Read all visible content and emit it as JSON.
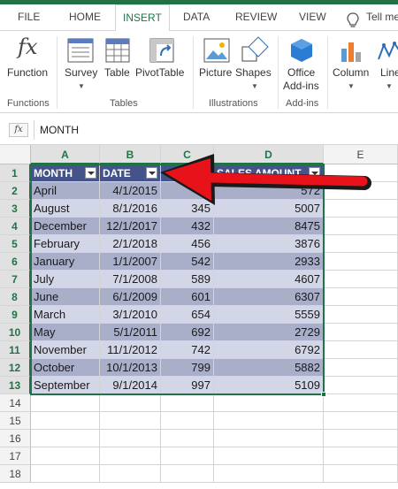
{
  "tabs": [
    "FILE",
    "HOME",
    "INSERT",
    "DATA",
    "REVIEW",
    "VIEW",
    "Tell me"
  ],
  "ribbon": {
    "function_label": "Function",
    "survey_label": "Survey",
    "table_label": "Table",
    "pivot_label": "PivotTable",
    "picture_label": "Picture",
    "shapes_label": "Shapes",
    "office_label_1": "Office",
    "office_label_2": "Add-ins",
    "column_label": "Column",
    "line_label": "Line",
    "fx_symbol": "fx",
    "groups": [
      "Functions",
      "Tables",
      "Illustrations",
      "Add-ins"
    ]
  },
  "formula_bar": {
    "fx": "fx",
    "value": "MONTH"
  },
  "grid": {
    "columns": [
      "A",
      "B",
      "C",
      "D",
      "E"
    ],
    "rows": [
      "1",
      "2",
      "3",
      "4",
      "5",
      "6",
      "7",
      "8",
      "9",
      "10",
      "11",
      "12",
      "13",
      "14",
      "15",
      "16",
      "17",
      "18"
    ],
    "headers": [
      "MONTH",
      "DATE",
      "",
      "SALES AMOUNT"
    ],
    "records": [
      [
        "April",
        "4/1/2015",
        "1",
        "572"
      ],
      [
        "August",
        "8/1/2016",
        "345",
        "5007"
      ],
      [
        "December",
        "12/1/2017",
        "432",
        "8475"
      ],
      [
        "February",
        "2/1/2018",
        "456",
        "3876"
      ],
      [
        "January",
        "1/1/2007",
        "542",
        "2933"
      ],
      [
        "July",
        "7/1/2008",
        "589",
        "4607"
      ],
      [
        "June",
        "6/1/2009",
        "601",
        "6307"
      ],
      [
        "March",
        "3/1/2010",
        "654",
        "5559"
      ],
      [
        "May",
        "5/1/2011",
        "692",
        "2729"
      ],
      [
        "November",
        "11/1/2012",
        "742",
        "6792"
      ],
      [
        "October",
        "10/1/2013",
        "799",
        "5882"
      ],
      [
        "September",
        "9/1/2014",
        "997",
        "5109"
      ]
    ]
  },
  "colors": {
    "accent": "#217346",
    "table_header": "#44548a",
    "band_dark": "#a9aec9",
    "band_light": "#d3d6e6",
    "arrow": "#e8121b"
  }
}
